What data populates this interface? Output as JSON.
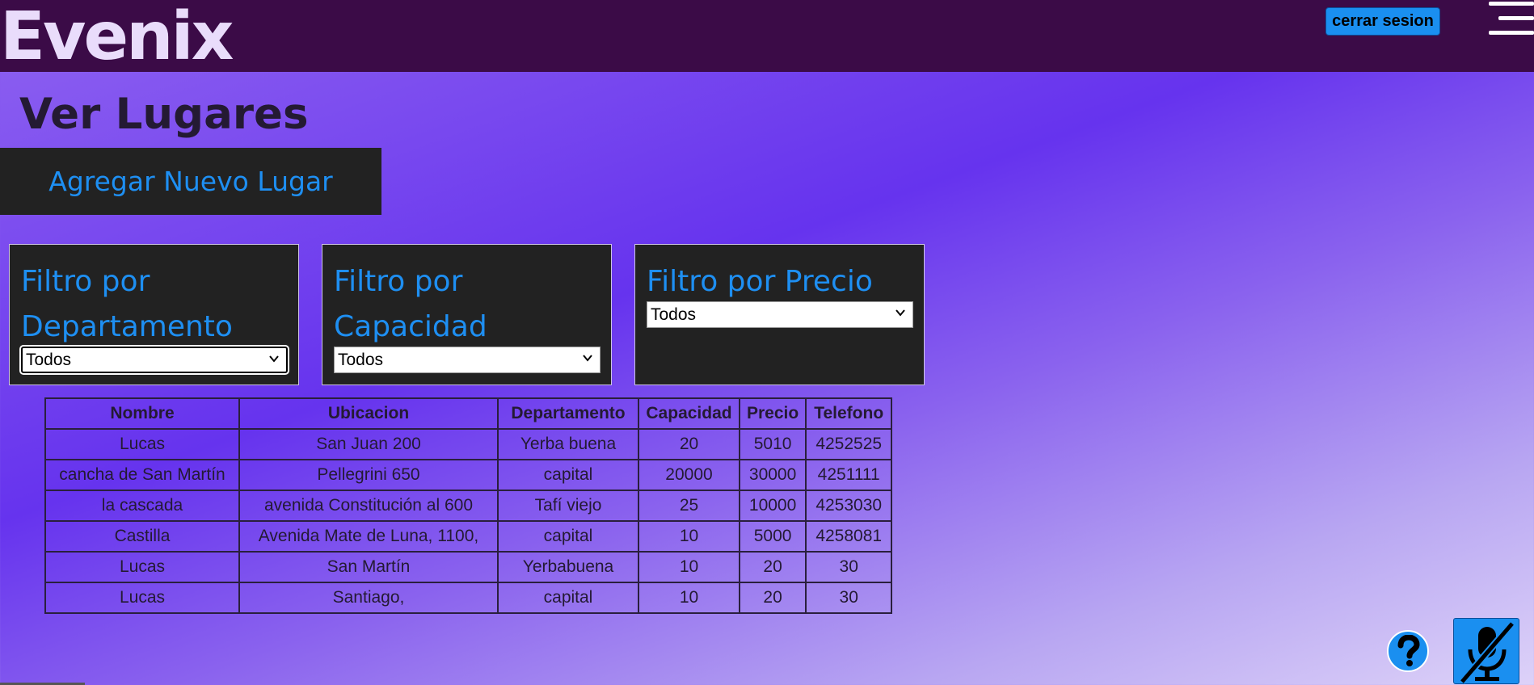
{
  "header": {
    "brand": "Evenix",
    "logout_label": "cerrar sesion"
  },
  "page": {
    "title": "Ver Lugares",
    "add_label": "Agregar Nuevo Lugar"
  },
  "filters": {
    "departamento": {
      "title": "Filtro por Departamento",
      "selected": "Todos"
    },
    "capacidad": {
      "title": "Filtro por Capacidad",
      "selected": "Todos"
    },
    "precio": {
      "title": "Filtro por Precio",
      "selected": "Todos"
    }
  },
  "table": {
    "columns": [
      "Nombre",
      "Ubicacion",
      "Departamento",
      "Capacidad",
      "Precio",
      "Telefono"
    ],
    "rows": [
      [
        "Lucas",
        "San Juan 200",
        "Yerba buena",
        "20",
        "5010",
        "4252525"
      ],
      [
        "cancha de San Martín",
        "Pellegrini 650",
        "capital",
        "20000",
        "30000",
        "4251111"
      ],
      [
        "la cascada",
        "avenida Constitución al 600",
        "Tafí viejo",
        "25",
        "10000",
        "4253030"
      ],
      [
        "Castilla",
        "Avenida Mate de Luna, 1100,",
        "capital",
        "10",
        "5000",
        "4258081"
      ],
      [
        "Lucas",
        "San Martín",
        "Yerbabuena",
        "10",
        "20",
        "30"
      ],
      [
        "Lucas",
        "Santiago,",
        "capital",
        "10",
        "20",
        "30"
      ]
    ]
  },
  "icons": {
    "menu": "hamburger-menu-icon",
    "help": "question-mark-icon",
    "mic": "microphone-muted-icon",
    "dropdown": "chevron-down-icon"
  },
  "colors": {
    "header_bg": "#3b0b47",
    "accent": "#1a8ff0",
    "panel_bg": "#222222",
    "link_text": "#1e8ff2"
  }
}
